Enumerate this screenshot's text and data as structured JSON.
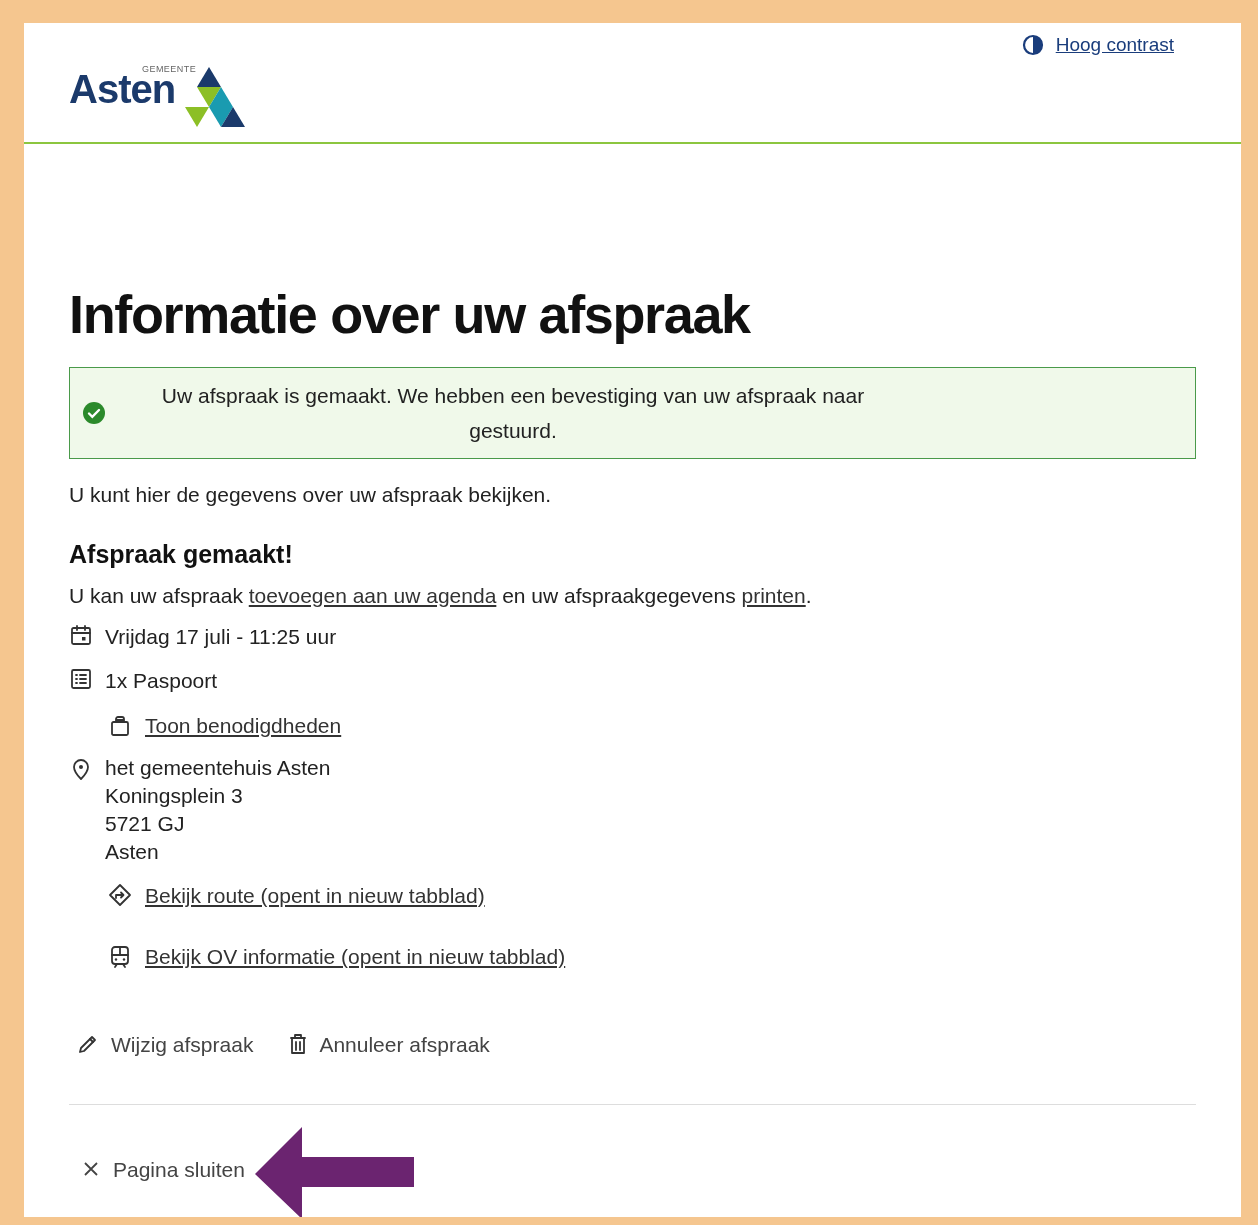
{
  "header": {
    "logo": {
      "small_text": "GEMEENTE",
      "name": "Asten"
    },
    "contrast_link": "Hoog contrast"
  },
  "title": "Informatie over uw afspraak",
  "alert": {
    "kind": "success",
    "message": "Uw afspraak is gemaakt. We hebben een bevestiging van uw afspraak naar gestuurd."
  },
  "intro": "U kunt hier de gegevens over uw afspraak bekijken.",
  "section_title": "Afspraak gemaakt!",
  "calendar_line": [
    {
      "kind": "text",
      "text": "U kan uw afspraak "
    },
    {
      "kind": "link",
      "text": "toevoegen aan uw agenda"
    },
    {
      "kind": "text",
      "text": " en uw afspraakgegevens "
    },
    {
      "kind": "link",
      "text": "printen"
    },
    {
      "kind": "text",
      "text": "."
    }
  ],
  "details": [
    {
      "kind": "date",
      "text": "Vrijdag 17 juli - 11:25 uur"
    },
    {
      "kind": "product",
      "text": "1x Paspoort",
      "links": [
        {
          "kind": "bag",
          "text": "Toon benodigdheden"
        }
      ]
    },
    {
      "kind": "location",
      "lines": [
        "het gemeentehuis Asten",
        "Koningsplein 3",
        "5721 GJ",
        "Asten"
      ],
      "links": [
        {
          "kind": "route",
          "text": "Bekijk route (opent in nieuw tabblad)"
        },
        {
          "kind": "bus",
          "text": "Bekijk OV informatie (opent in nieuw tabblad)"
        }
      ]
    }
  ],
  "actions": [
    {
      "kind": "edit",
      "label": "Wijzig afspraak"
    },
    {
      "kind": "delete",
      "label": "Annuleer afspraak"
    }
  ],
  "close_button": "Pagina sluiten"
}
